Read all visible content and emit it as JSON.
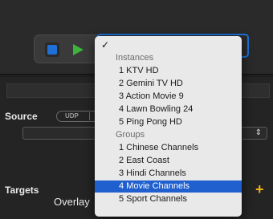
{
  "top_select": {
    "chevron": "⇕"
  },
  "source": {
    "label": "Source",
    "segment_udp": "UDP",
    "chevron": "⇕"
  },
  "targets": {
    "label": "Targets",
    "overlay": "Overlay",
    "plus": "+"
  },
  "menu": {
    "checkmark": "✓",
    "instances_header": "Instances",
    "instances": [
      "1 KTV HD",
      "2 Gemini TV HD",
      "3 Action Movie 9",
      "4 Lawn Bowling 24",
      "5 Ping Pong HD"
    ],
    "groups_header": "Groups",
    "groups": [
      "1 Chinese Channels",
      "2 East Coast",
      "3 Hindi Channels",
      "4 Movie Channels",
      "5 Sport Channels"
    ],
    "selected": "4 Movie Channels"
  },
  "colors": {
    "accent": "#1f5fce",
    "stop": "#1f6fd6",
    "play": "#3cb43c",
    "plus": "#f2b21b"
  }
}
